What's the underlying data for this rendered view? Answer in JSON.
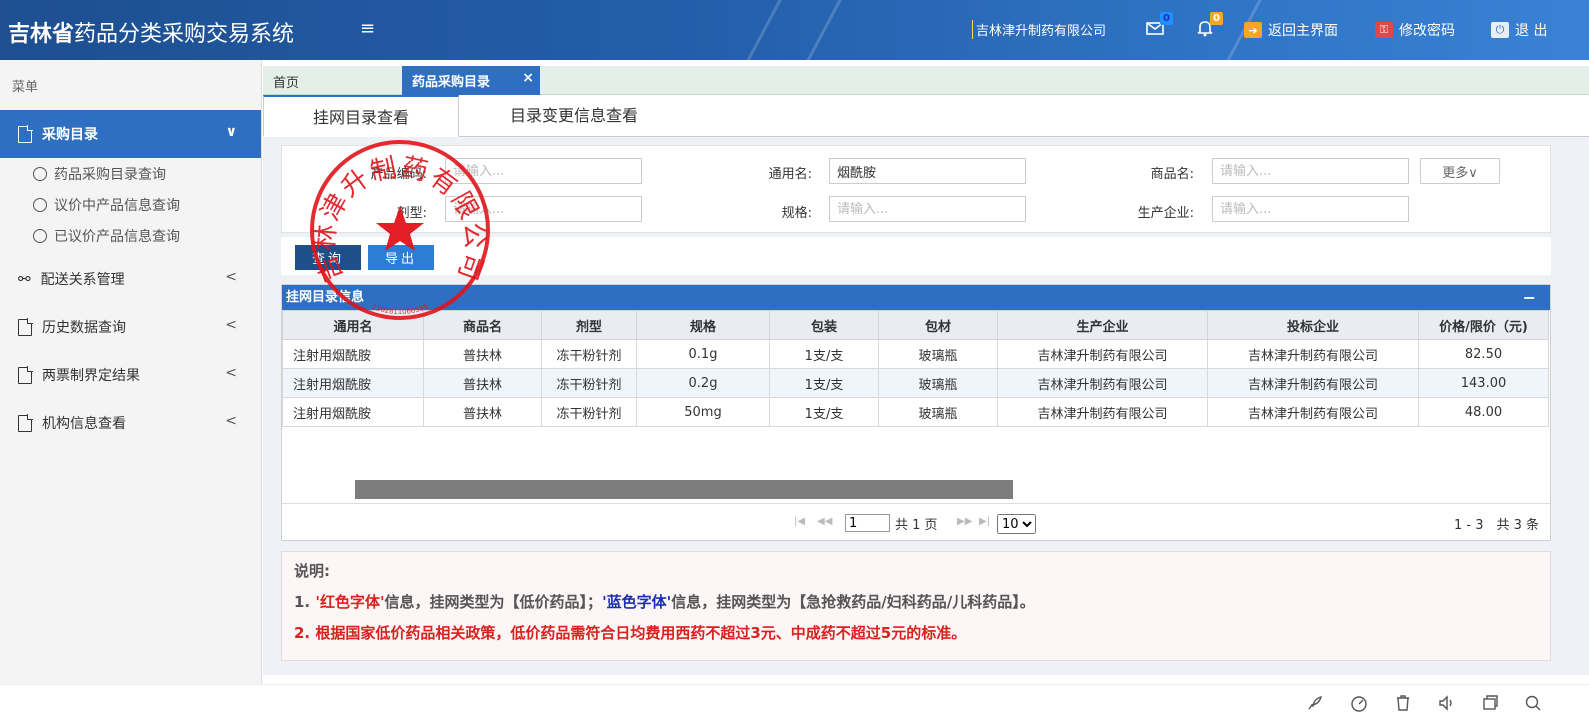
{
  "header": {
    "title_bold": "吉林省",
    "title_rest": "药品分类采购交易系统",
    "menu_toggle": "≡",
    "company": "吉林津升制药有限公司",
    "mail_badge": "0",
    "bell_badge": "0",
    "home_label": "返回主界面",
    "password_label": "修改密码",
    "logout_label": "退 出"
  },
  "sidebar": {
    "menu_title": "菜单",
    "active": {
      "label": "采购目录",
      "chevron": "∨"
    },
    "sub_items": [
      "药品采购目录查询",
      "议价中产品信息查询",
      "已议价产品信息查询"
    ],
    "items": [
      {
        "label": "配送关系管理",
        "chevron": "<"
      },
      {
        "label": "历史数据查询",
        "chevron": "<"
      },
      {
        "label": "两票制界定结果",
        "chevron": "<"
      },
      {
        "label": "机构信息查看",
        "chevron": "<"
      }
    ]
  },
  "tabs": {
    "home": "首页",
    "active": "药品采购目录",
    "close": "×"
  },
  "subtabs": [
    "挂网目录查看",
    "目录变更信息查看"
  ],
  "search": {
    "product_code_label": "产品编码:",
    "product_code_placeholder": "请输入...",
    "generic_name_label": "通用名:",
    "generic_name_value": "烟酰胺",
    "trade_name_label": "商品名:",
    "trade_name_placeholder": "请输入...",
    "more_label": "更多∨",
    "dosage_label": "剂型:",
    "dosage_placeholder": "请输入...",
    "spec_label": "规格:",
    "spec_placeholder": "请输入...",
    "manufacturer_label": "生产企业:",
    "manufacturer_placeholder": "请输入..."
  },
  "actions": {
    "query": "查询",
    "export": "导出"
  },
  "grid": {
    "title": "挂网目录信息",
    "collapse": "−",
    "columns": [
      "通用名",
      "商品名",
      "剂型",
      "规格",
      "包装",
      "包材",
      "生产企业",
      "投标企业",
      "价格/限价（元)"
    ],
    "rows": [
      [
        "注射用烟酰胺",
        "普扶林",
        "冻干粉针剂",
        "0.1g",
        "1支/支",
        "玻璃瓶",
        "吉林津升制药有限公司",
        "吉林津升制药有限公司",
        "82.50"
      ],
      [
        "注射用烟酰胺",
        "普扶林",
        "冻干粉针剂",
        "0.2g",
        "1支/支",
        "玻璃瓶",
        "吉林津升制药有限公司",
        "吉林津升制药有限公司",
        "143.00"
      ],
      [
        "注射用烟酰胺",
        "普扶林",
        "冻干粉针剂",
        "50mg",
        "1支/支",
        "玻璃瓶",
        "吉林津升制药有限公司",
        "吉林津升制药有限公司",
        "48.00"
      ]
    ]
  },
  "pager": {
    "page_value": "1",
    "total_pages_text": "共 1 页",
    "page_size": "10",
    "summary": "1 - 3　共 3 条",
    "first": "|◀",
    "prev": "◀◀",
    "next": "▶▶",
    "last": "▶|"
  },
  "notes": {
    "title": "说明:",
    "line1": {
      "prefix": "1. ",
      "red_term": "'红色字体'",
      "mid": "信息，挂网类型为【低价药品】；",
      "blue_term": "'蓝色字体'",
      "suffix": "信息，挂网类型为【急抢救药品/妇科药品/儿科药品】。"
    },
    "line2": "2. 根据国家低价药品相关政策，低价药品需符合日均费用西药不超过3元、中成药不超过5元的标准。"
  },
  "seal": {
    "text": "吉林津升制药有限公司",
    "code": "2202811066535"
  },
  "colors": {
    "primary": "#2e6fc2",
    "header": "#245fab",
    "seal": "#e0141a",
    "note_red": "#d9211e",
    "note_blue": "#1a2fb3"
  }
}
